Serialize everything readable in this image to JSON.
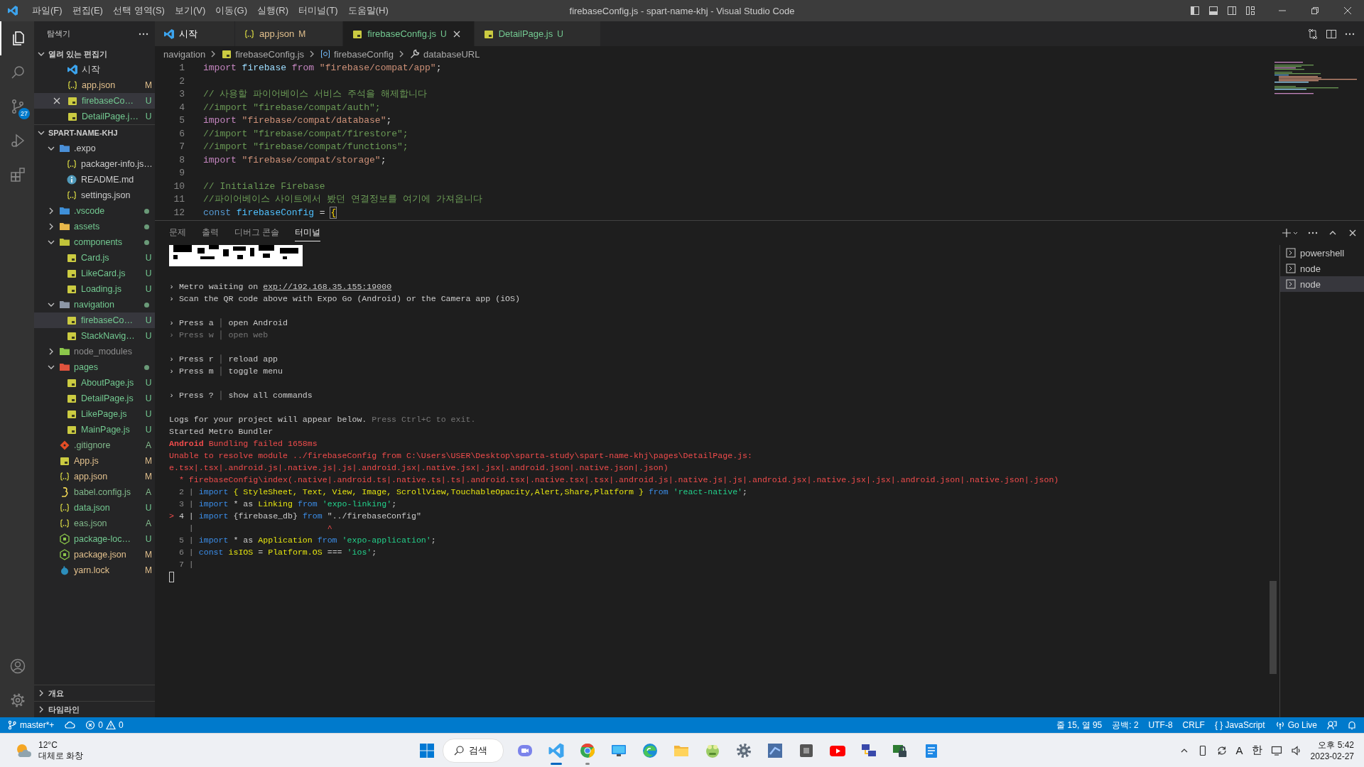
{
  "title_bar": {
    "menu": [
      "파일(F)",
      "편집(E)",
      "선택 영역(S)",
      "보기(V)",
      "이동(G)",
      "실행(R)",
      "터미널(T)",
      "도움말(H)"
    ],
    "title": "firebaseConfig.js - spart-name-khj - Visual Studio Code"
  },
  "activity_bar": {
    "items": [
      {
        "kind": "explorer",
        "selected": true
      },
      {
        "kind": "search",
        "selected": false
      },
      {
        "kind": "source-control",
        "selected": false,
        "badge": "27"
      },
      {
        "kind": "run-debug",
        "selected": false
      },
      {
        "kind": "extensions",
        "selected": false
      }
    ],
    "bottom": [
      {
        "kind": "account"
      },
      {
        "kind": "settings"
      }
    ]
  },
  "sidebar": {
    "title": "탐색기",
    "open_editors": {
      "title": "열려 있는 편집기",
      "expanded": true,
      "items": [
        {
          "name": "시작",
          "kind": "vscode",
          "selected": false
        },
        {
          "name": "app.json",
          "kind": "json",
          "status": "M",
          "selected": false
        },
        {
          "name": "firebaseCo…",
          "kind": "js",
          "status": "U",
          "selected": true
        },
        {
          "name": "DetailPage.j…",
          "kind": "js",
          "status": "U",
          "selected": false
        }
      ]
    },
    "workspace": {
      "title": "SPART-NAME-KHJ",
      "expanded": true,
      "tree": [
        {
          "name": ".expo",
          "kind": "folder",
          "color": "#4a8fd8",
          "expanded": true,
          "selected": false,
          "children": [
            {
              "name": "packager-info.js…",
              "kind": "json",
              "selected": false
            },
            {
              "name": "README.md",
              "kind": "info",
              "selected": false
            },
            {
              "name": "settings.json",
              "kind": "json",
              "selected": false
            }
          ]
        },
        {
          "name": ".vscode",
          "kind": "folder",
          "color": "#3f8fd8",
          "expanded": false,
          "dot": true,
          "selected": false
        },
        {
          "name": "assets",
          "kind": "folder",
          "color": "#e8b74a",
          "expanded": false,
          "dot": true,
          "selected": false
        },
        {
          "name": "components",
          "kind": "folder",
          "color": "#c0c33a",
          "expanded": true,
          "dot": true,
          "selected": false,
          "children": [
            {
              "name": "Card.js",
              "kind": "js",
              "status": "U",
              "selected": false
            },
            {
              "name": "LikeCard.js",
              "kind": "js",
              "status": "U",
              "selected": false
            },
            {
              "name": "Loading.js",
              "kind": "js",
              "status": "U",
              "selected": false
            }
          ]
        },
        {
          "name": "navigation",
          "kind": "folder",
          "color": "#8c96a6",
          "expanded": true,
          "dot": true,
          "selected": false,
          "children": [
            {
              "name": "firebaseCo…",
              "kind": "js",
              "status": "U",
              "selected": true
            },
            {
              "name": "StackNavig…",
              "kind": "js",
              "status": "U",
              "selected": false
            }
          ]
        },
        {
          "name": "node_modules",
          "kind": "folder",
          "color": "#8cc84b",
          "expanded": false,
          "ignored": true,
          "selected": false
        },
        {
          "name": "pages",
          "kind": "folder",
          "color": "#e0533d",
          "expanded": true,
          "dot": true,
          "selected": false,
          "children": [
            {
              "name": "AboutPage.js",
              "kind": "js",
              "status": "U",
              "selected": false
            },
            {
              "name": "DetailPage.js",
              "kind": "js",
              "status": "U",
              "selected": false
            },
            {
              "name": "LikePage.js",
              "kind": "js",
              "status": "U",
              "selected": false
            },
            {
              "name": "MainPage.js",
              "kind": "js",
              "status": "U",
              "selected": false
            }
          ]
        },
        {
          "name": ".gitignore",
          "kind": "git",
          "status": "A",
          "selected": false
        },
        {
          "name": "App.js",
          "kind": "js",
          "status": "M",
          "selected": false
        },
        {
          "name": "app.json",
          "kind": "json",
          "status": "M",
          "selected": false
        },
        {
          "name": "babel.config.js",
          "kind": "babel",
          "status": "A",
          "selected": false
        },
        {
          "name": "data.json",
          "kind": "json",
          "status": "U",
          "selected": false
        },
        {
          "name": "eas.json",
          "kind": "json",
          "status": "A",
          "selected": false
        },
        {
          "name": "package-loc…",
          "kind": "node",
          "status": "U",
          "selected": false
        },
        {
          "name": "package.json",
          "kind": "node",
          "status": "M",
          "selected": false
        },
        {
          "name": "yarn.lock",
          "kind": "yarn",
          "status": "M",
          "selected": false
        }
      ]
    },
    "sections": [
      {
        "title": "개요",
        "expanded": false
      },
      {
        "title": "타임라인",
        "expanded": false
      }
    ]
  },
  "editor": {
    "tabs": [
      {
        "label": "시작",
        "kind": "vscode",
        "selected": false
      },
      {
        "label": "app.json",
        "kind": "json",
        "status": "M",
        "selected": false
      },
      {
        "label": "firebaseConfig.js",
        "kind": "js",
        "status": "U",
        "selected": true
      },
      {
        "label": "DetailPage.js",
        "kind": "js",
        "status": "U",
        "selected": false
      }
    ],
    "breadcrumbs": [
      {
        "label": "navigation",
        "kind": "folder"
      },
      {
        "label": "firebaseConfig.js",
        "kind": "js"
      },
      {
        "label": "firebaseConfig",
        "kind": "object"
      },
      {
        "label": "databaseURL",
        "kind": "property"
      }
    ],
    "lines": [
      {
        "number": "1",
        "tokens": [
          {
            "text": "import ",
            "kind": "keyword"
          },
          {
            "text": "firebase ",
            "kind": "variable"
          },
          {
            "text": "from ",
            "kind": "keyword"
          },
          {
            "text": "\"firebase/compat/app\"",
            "kind": "string"
          },
          {
            "text": ";",
            "kind": "plain"
          }
        ]
      },
      {
        "number": "2"
      },
      {
        "number": "3",
        "tokens": [
          {
            "text": "// 사용할 파이어베이스 서비스 주석을 해제합니다",
            "kind": "comment"
          }
        ]
      },
      {
        "number": "4",
        "tokens": [
          {
            "text": "//import \"firebase/compat/auth\";",
            "kind": "comment"
          }
        ]
      },
      {
        "number": "5",
        "tokens": [
          {
            "text": "import ",
            "kind": "keyword"
          },
          {
            "text": "\"firebase/compat/database\"",
            "kind": "string"
          },
          {
            "text": ";",
            "kind": "plain"
          }
        ]
      },
      {
        "number": "6",
        "tokens": [
          {
            "text": "//import \"firebase/compat/firestore\";",
            "kind": "comment"
          }
        ]
      },
      {
        "number": "7",
        "tokens": [
          {
            "text": "//import \"firebase/compat/functions\";",
            "kind": "comment"
          }
        ]
      },
      {
        "number": "8",
        "tokens": [
          {
            "text": "import ",
            "kind": "keyword"
          },
          {
            "text": "\"firebase/compat/storage\"",
            "kind": "string"
          },
          {
            "text": ";",
            "kind": "plain"
          }
        ]
      },
      {
        "number": "9"
      },
      {
        "number": "10",
        "tokens": [
          {
            "text": "// Initialize Firebase",
            "kind": "comment"
          }
        ]
      },
      {
        "number": "11",
        "tokens": [
          {
            "text": "//파이어베이스 사이트에서 봤던 연결정보를 여기에 가져옵니다",
            "kind": "comment"
          }
        ]
      },
      {
        "number": "12",
        "tokens": [
          {
            "text": "const ",
            "kind": "storage"
          },
          {
            "text": "firebaseConfig ",
            "kind": "constant"
          },
          {
            "text": "= ",
            "kind": "plain"
          },
          {
            "text": "{",
            "kind": "bracket"
          }
        ]
      }
    ]
  },
  "panel": {
    "tabs": [
      {
        "label": "문제",
        "selected": false
      },
      {
        "label": "출력",
        "selected": false
      },
      {
        "label": "디버그 콘솔",
        "selected": false
      },
      {
        "label": "터미널",
        "selected": true
      }
    ],
    "terminal": {
      "lines": [
        {
          "tokens": [
            {
              "text": "› Metro waiting on ",
              "kind": "plain"
            },
            {
              "text": "exp://192.168.35.155:19000",
              "kind": "link"
            }
          ]
        },
        {
          "tokens": [
            {
              "text": "› Scan the QR code above with Expo Go (Android) or the Camera app (iOS)",
              "kind": "plain"
            }
          ]
        },
        {
          "space_before": true,
          "tokens": [
            {
              "text": "› Press a ",
              "kind": "plain"
            },
            {
              "text": "│",
              "kind": "sep"
            },
            {
              "text": " open Android",
              "kind": "plain"
            }
          ]
        },
        {
          "tokens": [
            {
              "text": "› Press w ",
              "kind": "dim"
            },
            {
              "text": "│",
              "kind": "sep"
            },
            {
              "text": " open web",
              "kind": "dim"
            }
          ]
        },
        {
          "space_before": true,
          "tokens": [
            {
              "text": "› Press r ",
              "kind": "plain"
            },
            {
              "text": "│",
              "kind": "sep"
            },
            {
              "text": " reload app",
              "kind": "plain"
            }
          ]
        },
        {
          "tokens": [
            {
              "text": "› Press m ",
              "kind": "plain"
            },
            {
              "text": "│",
              "kind": "sep"
            },
            {
              "text": " toggle menu",
              "kind": "plain"
            }
          ]
        },
        {
          "space_before": true,
          "tokens": [
            {
              "text": "› Press ? ",
              "kind": "plain"
            },
            {
              "text": "│",
              "kind": "sep"
            },
            {
              "text": " show all commands",
              "kind": "plain"
            }
          ]
        },
        {
          "space_before": true,
          "tokens": [
            {
              "text": "Logs for your project will appear below. ",
              "kind": "plain"
            },
            {
              "text": "Press Ctrl+C to exit.",
              "kind": "dim"
            }
          ]
        },
        {
          "tokens": [
            {
              "text": "Started Metro Bundler",
              "kind": "plain"
            }
          ]
        },
        {
          "tokens": [
            {
              "text": "Android",
              "kind": "error_bold"
            },
            {
              "text": " Bundling failed 1658ms",
              "kind": "error"
            }
          ]
        },
        {
          "tokens": [
            {
              "text": "Unable to resolve module ../firebaseConfig from C:\\Users\\USER\\Desktop\\sparta-study\\spart-name-khj\\pages\\DetailPage.js:",
              "kind": "error"
            }
          ]
        },
        {
          "tokens": [
            {
              "text": "e.tsx|.tsx|.android.js|.native.js|.js|.android.jsx|.native.jsx|.jsx|.android.json|.native.json|.json)",
              "kind": "error"
            }
          ]
        },
        {
          "tokens": [
            {
              "text": "  * firebaseConfig\\index(.native|.android.ts|.native.ts|.ts|.android.tsx|.native.tsx|.tsx|.android.js|.native.js|.js|.android.jsx|.native.jsx|.jsx|.android.json|.native.json|.json)",
              "kind": "error"
            }
          ]
        },
        {
          "tokens": [
            {
              "text": "  2 | ",
              "kind": "gutter"
            },
            {
              "text": "import ",
              "kind": "keyword"
            },
            {
              "text": "{ StyleSheet, Text, View, Image, ScrollView,TouchableOpacity,Alert,Share,Platform } ",
              "kind": "identifier"
            },
            {
              "text": "from ",
              "kind": "keyword"
            },
            {
              "text": "'react-native'",
              "kind": "string"
            },
            {
              "text": ";",
              "kind": "plain"
            }
          ]
        },
        {
          "tokens": [
            {
              "text": "  3 | ",
              "kind": "gutter"
            },
            {
              "text": "import ",
              "kind": "keyword"
            },
            {
              "text": "* as ",
              "kind": "plain"
            },
            {
              "text": "Linking ",
              "kind": "identifier"
            },
            {
              "text": "from ",
              "kind": "keyword"
            },
            {
              "text": "'expo-linking'",
              "kind": "string"
            },
            {
              "text": ";",
              "kind": "plain"
            }
          ]
        },
        {
          "tokens": [
            {
              "text": "> ",
              "kind": "marker"
            },
            {
              "text": "4 | ",
              "kind": "plain"
            },
            {
              "text": "import ",
              "kind": "keyword"
            },
            {
              "text": "{firebase_db} ",
              "kind": "plain"
            },
            {
              "text": "from ",
              "kind": "keyword"
            },
            {
              "text": "\"../firebaseConfig\"",
              "kind": "plain"
            }
          ]
        },
        {
          "tokens": [
            {
              "text": "    | ",
              "kind": "gutter"
            },
            {
              "text": "                          ^",
              "kind": "marker"
            }
          ]
        },
        {
          "tokens": [
            {
              "text": "  5 | ",
              "kind": "gutter"
            },
            {
              "text": "import ",
              "kind": "keyword"
            },
            {
              "text": "* as ",
              "kind": "plain"
            },
            {
              "text": "Application ",
              "kind": "identifier"
            },
            {
              "text": "from ",
              "kind": "keyword"
            },
            {
              "text": "'expo-application'",
              "kind": "string"
            },
            {
              "text": ";",
              "kind": "plain"
            }
          ]
        },
        {
          "tokens": [
            {
              "text": "  6 | ",
              "kind": "gutter"
            },
            {
              "text": "const ",
              "kind": "keyword"
            },
            {
              "text": "isIOS ",
              "kind": "identifier"
            },
            {
              "text": "= ",
              "kind": "plain"
            },
            {
              "text": "Platform.OS ",
              "kind": "identifier"
            },
            {
              "text": "=== ",
              "kind": "plain"
            },
            {
              "text": "'ios'",
              "kind": "string"
            },
            {
              "text": ";",
              "kind": "plain"
            }
          ]
        },
        {
          "tokens": [
            {
              "text": "  7 |",
              "kind": "gutter"
            }
          ]
        }
      ]
    },
    "terminals": [
      {
        "label": "powershell",
        "selected": false
      },
      {
        "label": "node",
        "selected": false
      },
      {
        "label": "node",
        "selected": true
      }
    ]
  },
  "status_bar": {
    "branch": "master*+",
    "errors": "0",
    "warnings": "0",
    "right": [
      {
        "text": "줄 15, 열 95",
        "kind": "text"
      },
      {
        "text": "공백: 2",
        "kind": "text"
      },
      {
        "text": "UTF-8",
        "kind": "text"
      },
      {
        "text": "CRLF",
        "kind": "text"
      },
      {
        "text": "{ } JavaScript",
        "kind": "text"
      },
      {
        "text": "Go Live",
        "kind": "live"
      }
    ]
  },
  "taskbar": {
    "weather": {
      "temperature": "12°C",
      "condition": "대체로 화창"
    },
    "search": "검색",
    "apps": [
      {
        "kind": "chat",
        "selected": false,
        "running": false
      },
      {
        "kind": "vscode",
        "selected": true,
        "running": true
      },
      {
        "kind": "chrome",
        "selected": false,
        "running": true
      },
      {
        "kind": "monitor",
        "selected": false,
        "running": false
      },
      {
        "kind": "edge",
        "selected": false,
        "running": false
      },
      {
        "kind": "folder",
        "selected": false,
        "running": false
      },
      {
        "kind": "frog",
        "selected": false,
        "running": false
      },
      {
        "kind": "settings",
        "selected": false,
        "running": false
      },
      {
        "kind": "blue-app",
        "selected": false,
        "running": false
      },
      {
        "kind": "grey-app",
        "selected": false,
        "running": false
      },
      {
        "kind": "youtube",
        "selected": false,
        "running": false
      },
      {
        "kind": "network",
        "selected": false,
        "running": false
      },
      {
        "kind": "lock",
        "selected": false,
        "running": false
      },
      {
        "kind": "notepad",
        "selected": false,
        "running": false
      }
    ],
    "tray": [
      "A",
      "한"
    ],
    "time": "오후 5:42",
    "date": "2023-02-27"
  }
}
